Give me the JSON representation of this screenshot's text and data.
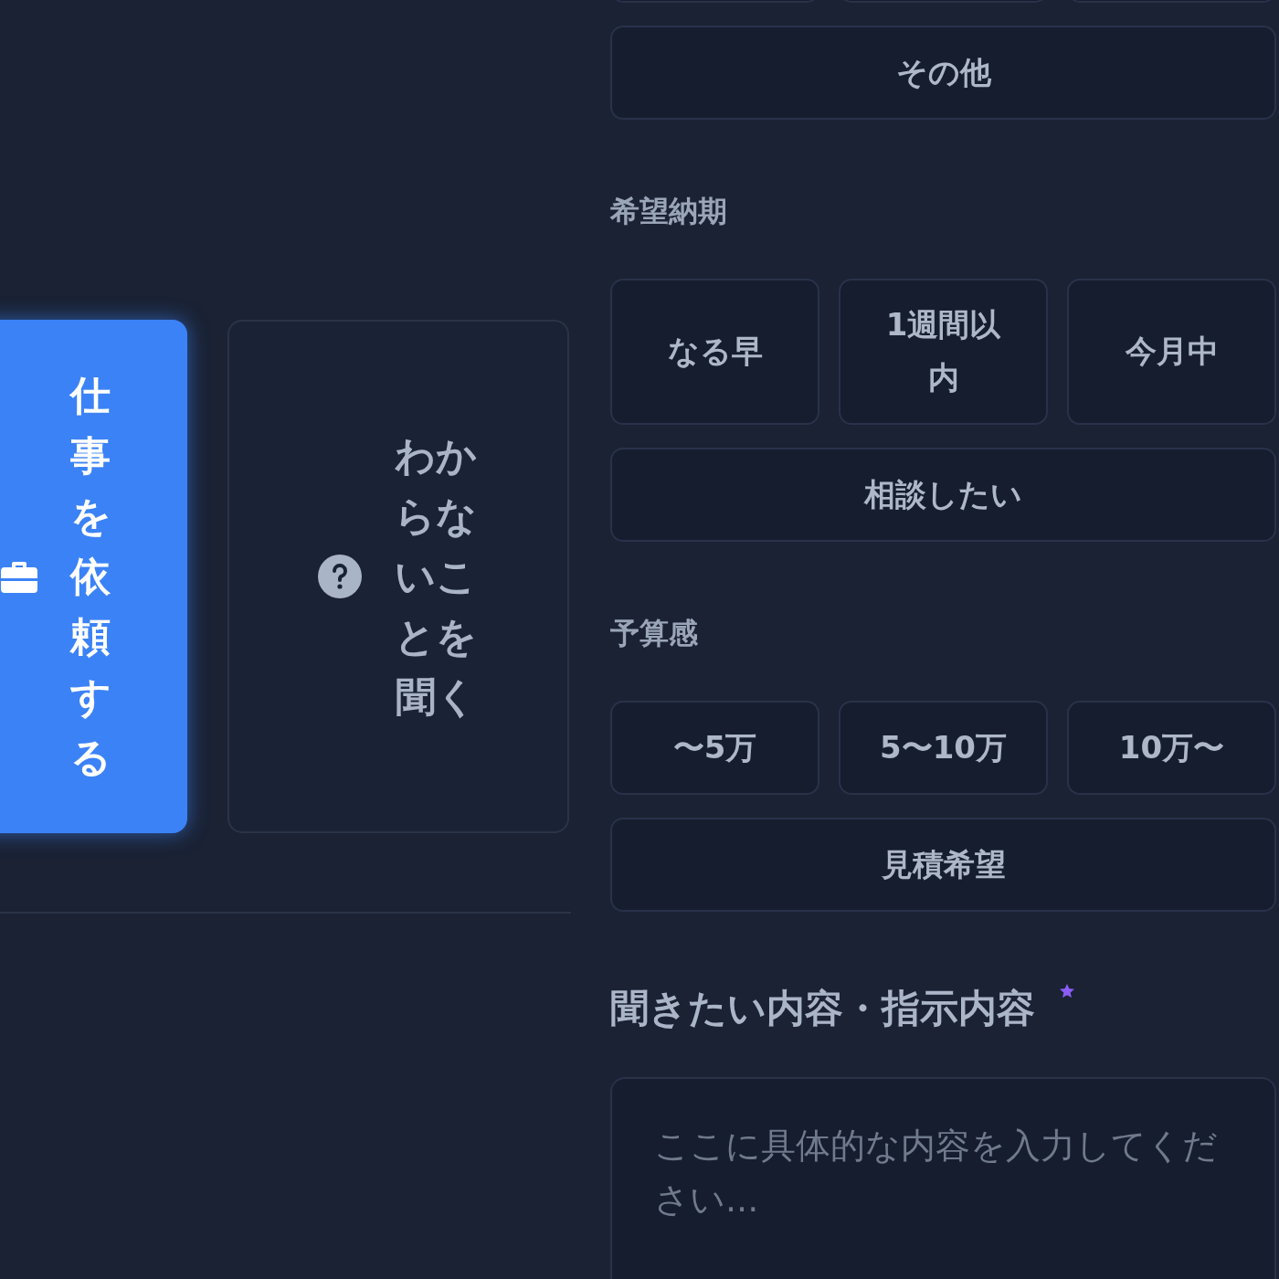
{
  "request_type": {
    "options": [
      {
        "label": "仕事を依頼する",
        "kind": "briefcase",
        "selected": true
      },
      {
        "label": "わからないことを聞く",
        "kind": "question",
        "selected": false
      }
    ]
  },
  "category": {
    "options": [
      {
        "selected": false
      },
      {
        "selected": false
      },
      {
        "selected": false
      },
      {
        "label": "その他",
        "selected": false
      }
    ]
  },
  "deadline": {
    "label": "希望納期",
    "options": [
      {
        "label": "なる早",
        "selected": false
      },
      {
        "label": "1週間以内",
        "selected": false
      },
      {
        "label": "今月中",
        "selected": false
      },
      {
        "label": "相談したい",
        "selected": false
      }
    ]
  },
  "budget": {
    "label": "予算感",
    "options": [
      {
        "label": "〜5万",
        "selected": false
      },
      {
        "label": "5〜10万",
        "selected": false
      },
      {
        "label": "10万〜",
        "selected": false
      },
      {
        "label": "見積希望",
        "selected": false
      }
    ]
  },
  "message": {
    "label": "聞きたい内容・指示内容",
    "required": true,
    "placeholder": "ここに具体的な内容を入力してください..."
  }
}
